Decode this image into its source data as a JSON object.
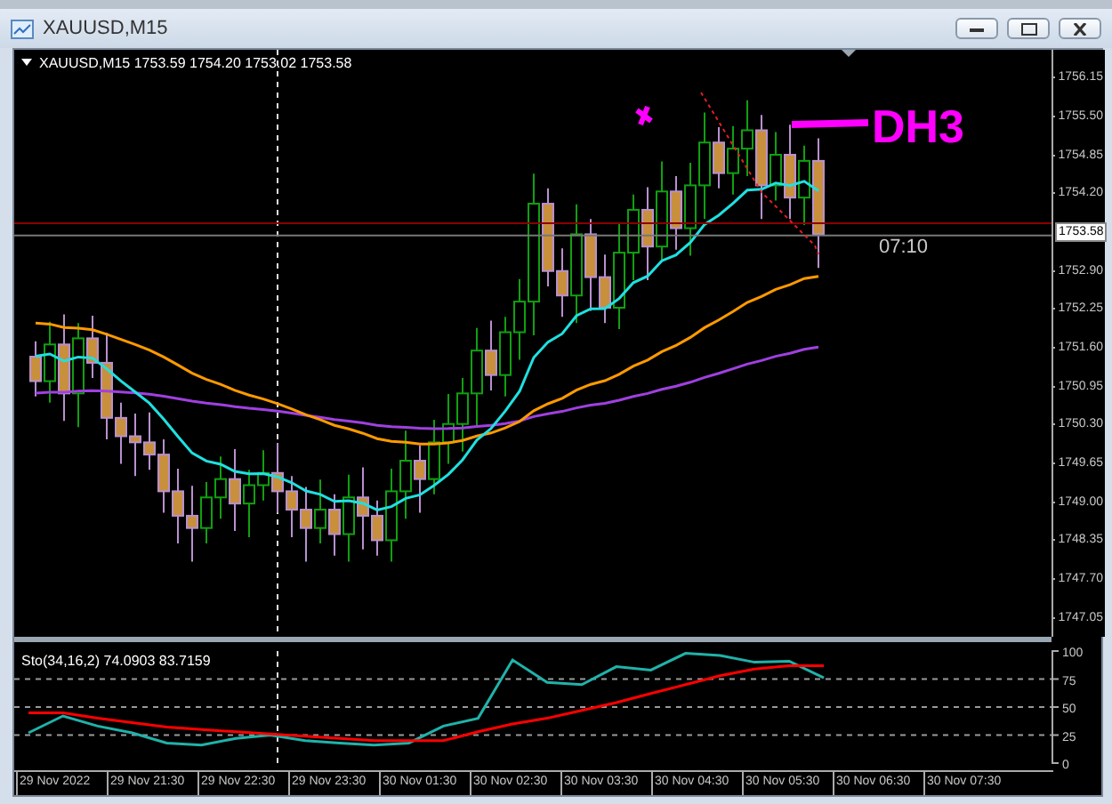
{
  "window": {
    "title": "XAUUSD,M15"
  },
  "chart": {
    "header": "XAUUSD,M15  1753.59 1754.20 1753.02 1753.58",
    "countdown": "07:10",
    "annotation": "DH3",
    "price_scale": [
      {
        "label": "1756.15",
        "kind": "tick"
      },
      {
        "label": "1755.50",
        "kind": "tick"
      },
      {
        "label": "1754.85",
        "kind": "tick"
      },
      {
        "label": "1754.20",
        "kind": "tick"
      },
      {
        "label": "1753.58",
        "kind": "current"
      },
      {
        "label": "1752.90",
        "kind": "tick"
      },
      {
        "label": "1752.25",
        "kind": "tick"
      },
      {
        "label": "1751.60",
        "kind": "tick"
      },
      {
        "label": "1750.95",
        "kind": "tick"
      },
      {
        "label": "1750.30",
        "kind": "tick"
      },
      {
        "label": "1749.65",
        "kind": "tick"
      },
      {
        "label": "1749.00",
        "kind": "tick"
      },
      {
        "label": "1748.35",
        "kind": "tick"
      },
      {
        "label": "1747.70",
        "kind": "tick"
      },
      {
        "label": "1747.05",
        "kind": "tick"
      }
    ]
  },
  "indicator": {
    "chart_data": {
      "type": "line",
      "title": "Sto(34,16,2) 74.0903 83.7159",
      "ylim": [
        0,
        100
      ],
      "grid": true,
      "yticks": [
        0,
        25,
        50,
        75,
        100
      ],
      "series": [
        {
          "color": "#20b2aa",
          "values": [
            27,
            42,
            33,
            27,
            18,
            16,
            22,
            25,
            20,
            18,
            16,
            18,
            33,
            40,
            92,
            72,
            70,
            86,
            83,
            98,
            96,
            90,
            91,
            76
          ]
        },
        {
          "color": "#ff0000",
          "values": [
            45,
            45,
            40,
            36,
            32,
            30,
            28,
            26,
            24,
            22,
            20,
            20,
            20,
            28,
            35,
            40,
            47,
            54,
            62,
            70,
            78,
            84,
            87,
            87
          ]
        }
      ]
    }
  },
  "time_axis": [
    "29 Nov 2022",
    "29 Nov 21:30",
    "29 Nov 22:30",
    "29 Nov 23:30",
    "30 Nov 01:30",
    "30 Nov 02:30",
    "30 Nov 03:30",
    "30 Nov 04:30",
    "30 Nov 05:30",
    "30 Nov 06:30",
    "30 Nov 07:30"
  ]
}
